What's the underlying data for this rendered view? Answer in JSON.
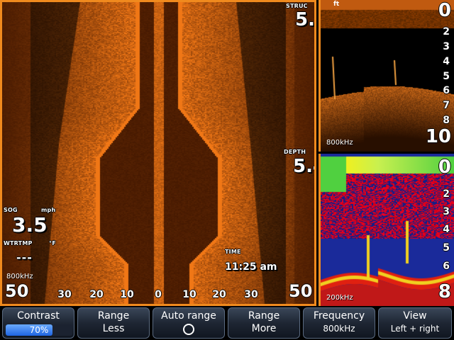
{
  "sidescan": {
    "struc_label": "STRUC",
    "struc_value": "5.7",
    "depth_label": "DEPTH",
    "depth_value": "5.4",
    "sog_label": "SOG",
    "sog_unit": "mph",
    "sog_value": "3.5",
    "wtrtmp_label": "WTRTMP",
    "wtrtmp_unit": "°F",
    "wtrtmp_value": "---",
    "time_label": "TIME",
    "time_value": "11:25 am",
    "frequency": "800kHz",
    "range_left": "50",
    "range_right": "50",
    "scale_ticks": [
      "30",
      "20",
      "10",
      "0",
      "10",
      "20",
      "30"
    ]
  },
  "downscan": {
    "unit": "ft",
    "top": "0",
    "ticks": [
      "2",
      "3",
      "4",
      "5",
      "6",
      "7",
      "8"
    ],
    "bottom": "10",
    "frequency": "800kHz"
  },
  "sonar": {
    "unit": "ft",
    "top": "0",
    "ticks": [
      "2",
      "3",
      "4",
      "5",
      "6"
    ],
    "bottom": "8",
    "frequency": "200kHz"
  },
  "toolbar": {
    "contrast": {
      "label": "Contrast",
      "value": "70%",
      "level": 0.7
    },
    "range_less": {
      "label": "Range",
      "sub": "Less"
    },
    "auto_range": {
      "label": "Auto range"
    },
    "range_more": {
      "label": "Range",
      "sub": "More"
    },
    "frequency": {
      "label": "Frequency",
      "sub": "800kHz"
    },
    "view": {
      "label": "View",
      "sub": "Left + right"
    }
  },
  "colors": {
    "accent": "#f08a1e",
    "sidescan": "#d07020",
    "button_fill": "#1e64e0"
  }
}
